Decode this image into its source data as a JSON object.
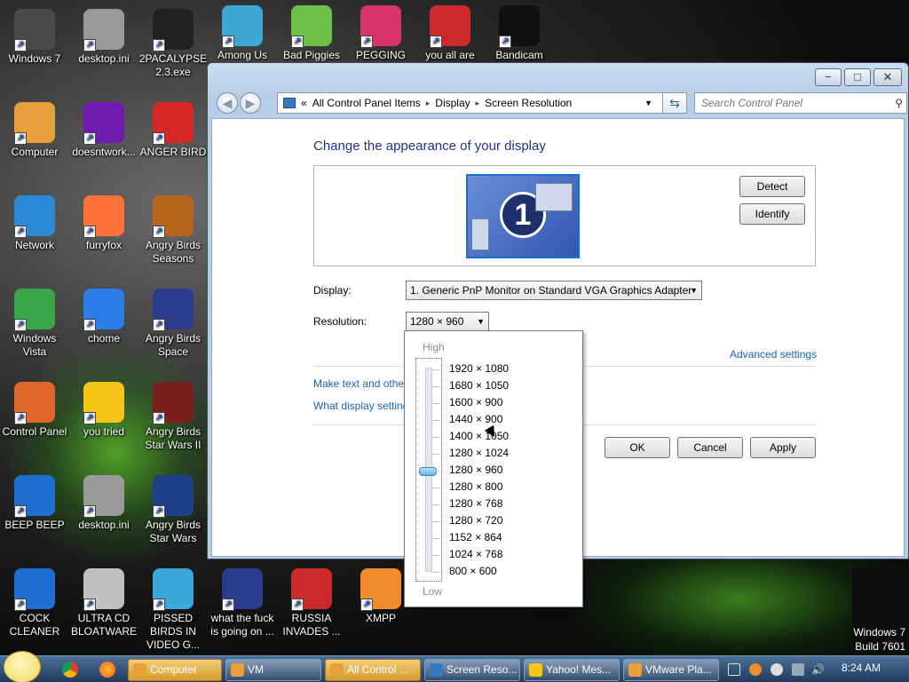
{
  "desktop": {
    "icons": [
      {
        "label": "Windows 7",
        "icon": "windows-icon",
        "color": "#4a4a4a"
      },
      {
        "label": "desktop.ini",
        "icon": "text-file-icon",
        "color": "#9a9a9a"
      },
      {
        "label": "2PACALYPSE 2.3.exe",
        "icon": "console-icon",
        "color": "#222222"
      },
      {
        "label": "Among Us",
        "icon": "among-us-icon",
        "color": "#3fa7d6"
      },
      {
        "label": "Bad Piggies",
        "icon": "bad-piggies-icon",
        "color": "#6cc04a"
      },
      {
        "label": "PEGGING",
        "icon": "pegging-icon",
        "color": "#d6336c"
      },
      {
        "label": "you all are",
        "icon": "devcpp-icon",
        "color": "#c92a2a"
      },
      {
        "label": "Bandicam",
        "icon": "bandicam-icon",
        "color": "#111111"
      },
      {
        "label": "Computer",
        "icon": "computer-icon",
        "color": "#e8a13a"
      },
      {
        "label": "doesntwork...",
        "icon": "yahoo-icon",
        "color": "#6f1ab1"
      },
      {
        "label": "ANGER BIRD",
        "icon": "angry-bird-icon",
        "color": "#d62828"
      },
      {
        "label": "Network",
        "icon": "network-icon",
        "color": "#2b8ad6"
      },
      {
        "label": "furryfox",
        "icon": "firefox-icon",
        "color": "#ff7139"
      },
      {
        "label": "Angry Birds Seasons",
        "icon": "angry-birds-seasons-icon",
        "color": "#b5651d"
      },
      {
        "label": "Windows Vista",
        "icon": "recycle-bin-icon",
        "color": "#3aa64a"
      },
      {
        "label": "chome",
        "icon": "chrome-icon",
        "color": "#2b7de9"
      },
      {
        "label": "Angry Birds Space",
        "icon": "angry-birds-space-icon",
        "color": "#2b3a8a"
      },
      {
        "label": "Control Panel",
        "icon": "control-panel-icon",
        "color": "#e0662b"
      },
      {
        "label": "you tried",
        "icon": "star-icon",
        "color": "#f5c518"
      },
      {
        "label": "Angry Birds Star Wars II",
        "icon": "angry-birds-star-wars-2-icon",
        "color": "#7a1f1f"
      },
      {
        "label": "BEEP BEEP",
        "icon": "blue-app-icon",
        "color": "#1f6fd0"
      },
      {
        "label": "desktop.ini",
        "icon": "text-file-icon",
        "color": "#9a9a9a"
      },
      {
        "label": "Angry Birds Star Wars",
        "icon": "angry-birds-star-wars-icon",
        "color": "#1f3f8a"
      },
      {
        "label": "COCK CLEANER",
        "icon": "blue-app-icon",
        "color": "#1f6fd0"
      },
      {
        "label": "ULTRA CD BLOATWARE",
        "icon": "cd-icon",
        "color": "#c0c0c0"
      },
      {
        "label": "PISSED BIRDS IN VIDEO G...",
        "icon": "angry-bird-icon",
        "color": "#3aa8d8"
      },
      {
        "label": "what the fuck is going on ...",
        "icon": "angry-birds-space-icon",
        "color": "#2b3a8a"
      },
      {
        "label": "RUSSIA INVADES ...",
        "icon": "radiation-icon",
        "color": "#c92a2a"
      },
      {
        "label": "XMPP",
        "icon": "xampp-icon",
        "color": "#f08c2b"
      }
    ],
    "watermark": {
      "line1": "Windows 7",
      "line2": "Build 7601"
    }
  },
  "window": {
    "controls": {
      "minimize": "−",
      "maximize": "□",
      "close": "✕"
    },
    "breadcrumb": [
      "«",
      "All Control Panel Items",
      "▸",
      "Display",
      "▸",
      "Screen Resolution"
    ],
    "search_placeholder": "Search Control Panel",
    "heading": "Change the appearance of your display",
    "monitor_number": "1",
    "detect_label": "Detect",
    "identify_label": "Identify",
    "display_label": "Display:",
    "display_value": "1. Generic PnP Monitor on Standard VGA Graphics Adapter",
    "resolution_label": "Resolution:",
    "resolution_value": "1280 × 960",
    "advanced_link": "Advanced settings",
    "link1": "Make text and other",
    "link2": "What display setting",
    "ok_label": "OK",
    "cancel_label": "Cancel",
    "apply_label": "Apply"
  },
  "resolution_popup": {
    "high_label": "High",
    "low_label": "Low",
    "options": [
      "1920 × 1080",
      "1680 × 1050",
      "1600 × 900",
      "1440 × 900",
      "1400 × 1050",
      "1280 × 1024",
      "1280 × 960",
      "1280 × 800",
      "1280 × 768",
      "1280 × 720",
      "1152 × 864",
      "1024 × 768",
      "800 × 600"
    ],
    "selected_index": 6
  },
  "taskbar": {
    "buttons": [
      {
        "label": "Computer",
        "active": true,
        "color": "#e8a13a"
      },
      {
        "label": "VM",
        "active": false,
        "color": "#e8a13a"
      },
      {
        "label": "All Control ...",
        "active": true,
        "color": "#e8a13a"
      },
      {
        "label": "Screen Reso...",
        "active": false,
        "color": "#3a78c2"
      },
      {
        "label": "Yahoo! Mes...",
        "active": false,
        "color": "#f5c518"
      },
      {
        "label": "VMware Pla...",
        "active": false,
        "color": "#e8a13a"
      }
    ],
    "clock": "8:24 AM"
  }
}
